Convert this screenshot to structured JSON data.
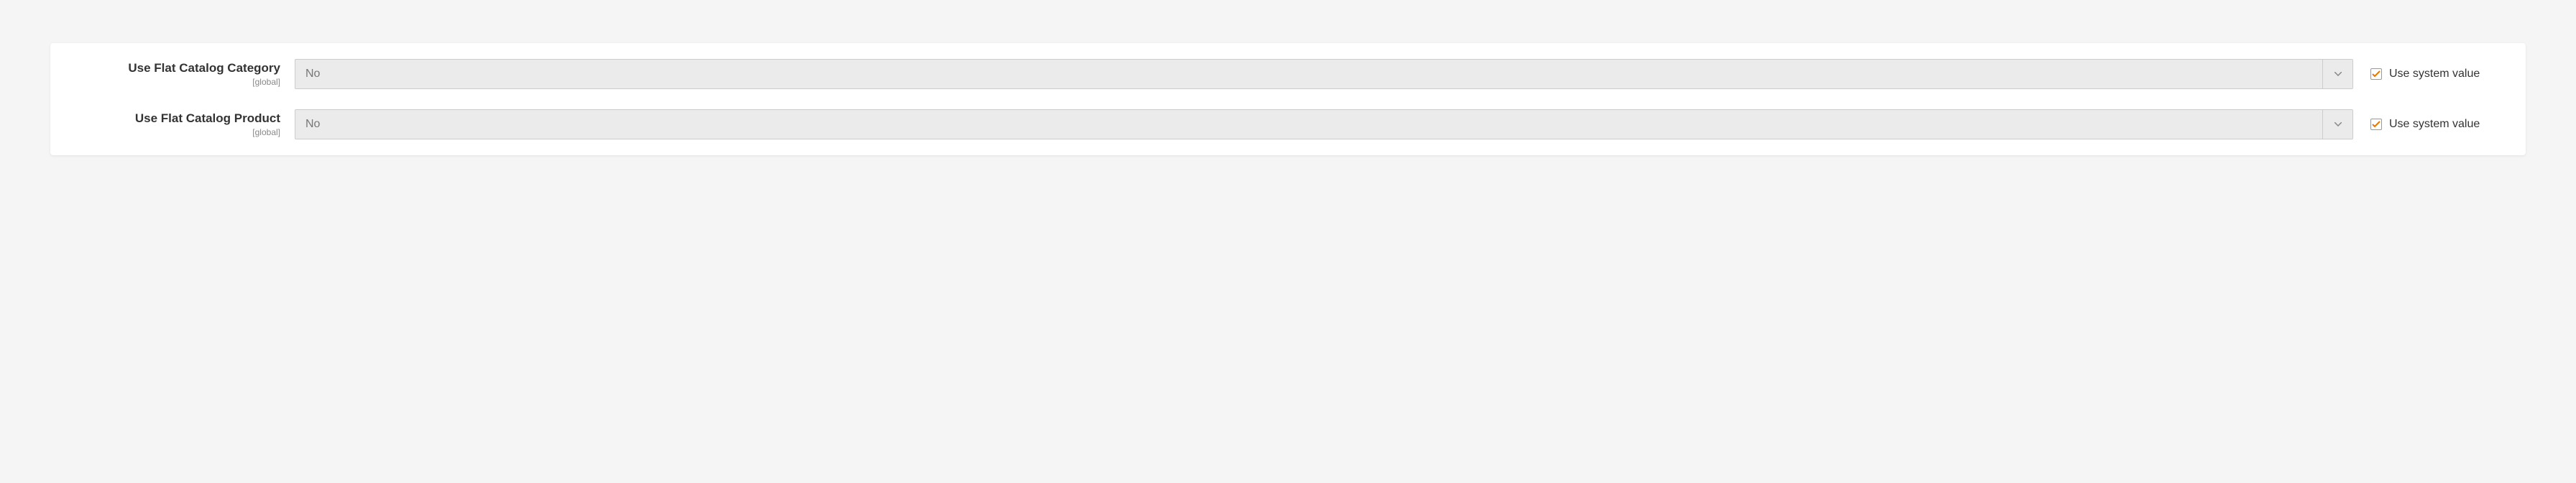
{
  "fields": [
    {
      "label": "Use Flat Catalog Category",
      "scope": "[global]",
      "value": "No",
      "use_system_label": "Use system value",
      "use_system_checked": true
    },
    {
      "label": "Use Flat Catalog Product",
      "scope": "[global]",
      "value": "No",
      "use_system_label": "Use system value",
      "use_system_checked": true
    }
  ]
}
